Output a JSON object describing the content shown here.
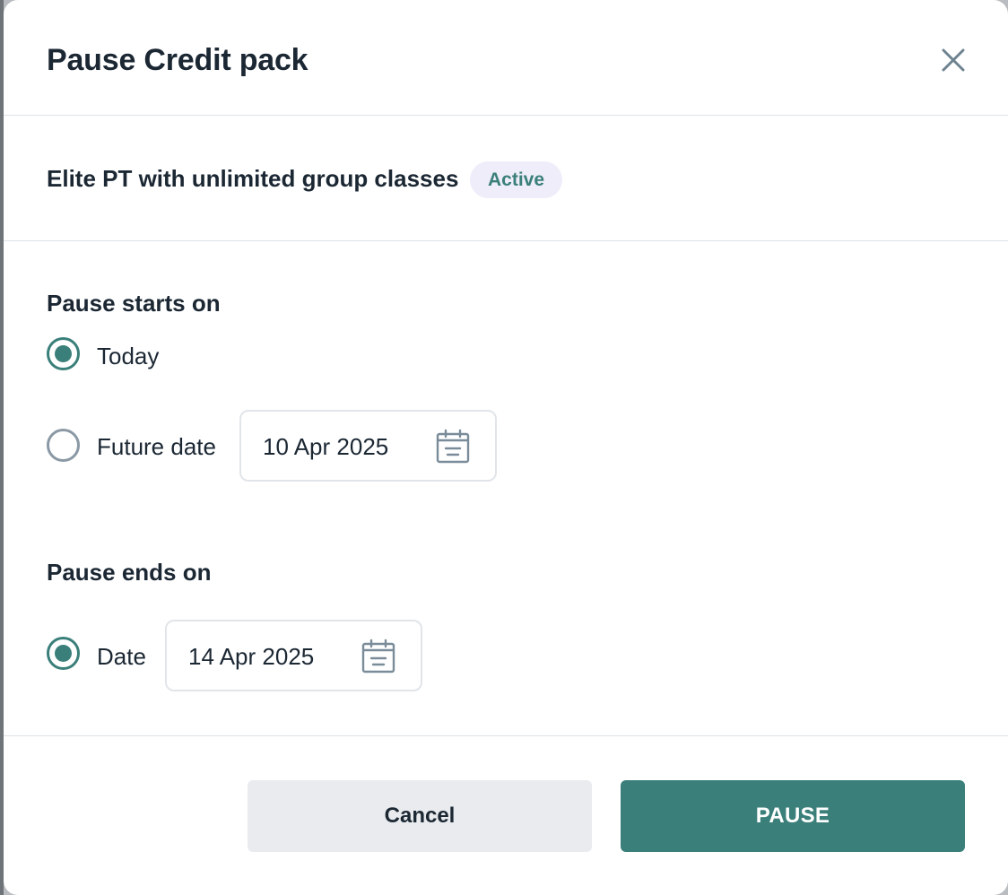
{
  "modal": {
    "title": "Pause Credit pack",
    "close_icon": "close-icon"
  },
  "pack": {
    "name": "Elite PT with unlimited group classes",
    "status": "Active"
  },
  "pause_start": {
    "label": "Pause starts on",
    "options": [
      {
        "label": "Today",
        "selected": true
      },
      {
        "label": "Future date",
        "selected": false,
        "date": "10 Apr 2025"
      }
    ]
  },
  "pause_end": {
    "label": "Pause ends on",
    "options": [
      {
        "label": "Date",
        "selected": true,
        "date": "14 Apr 2025"
      }
    ]
  },
  "footer": {
    "cancel_label": "Cancel",
    "pause_label": "PAUSE"
  },
  "colors": {
    "accent": "#3a7f7a",
    "badge_bg": "#efedfa",
    "text": "#1b2733"
  }
}
